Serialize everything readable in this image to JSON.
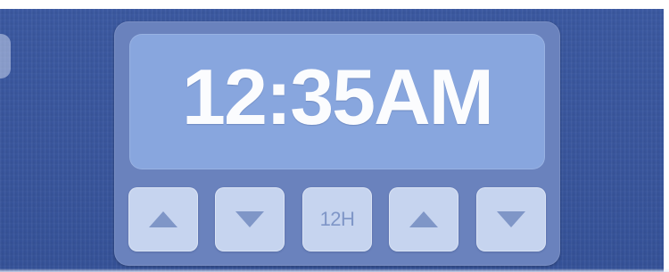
{
  "display": {
    "time": "12:35AM"
  },
  "controls": [
    {
      "icon": "triangle-up-icon",
      "label": ""
    },
    {
      "icon": "triangle-down-icon",
      "label": ""
    },
    {
      "icon": "",
      "label": "12H"
    },
    {
      "icon": "triangle-up-icon",
      "label": ""
    },
    {
      "icon": "triangle-down-icon",
      "label": ""
    }
  ],
  "colors": {
    "background": "#3a579f",
    "panel": "#6a82bd",
    "display": "#88a6de",
    "digits": "#fbfcfe",
    "button": "#c6d4ef",
    "button_glyph": "#7f96c7"
  }
}
